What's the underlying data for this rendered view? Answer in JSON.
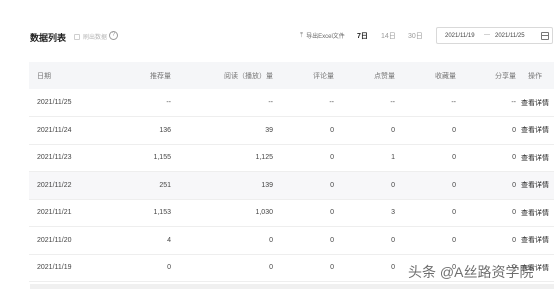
{
  "header": {
    "title": "数据列表",
    "brush_label": "刷出数据",
    "help_icon": "question-circle-icon",
    "export_icon": "upload-icon",
    "export_label": "导出Excel文件",
    "ranges": [
      "7日",
      "14日",
      "30日"
    ],
    "active_range": "7日",
    "date_start": "2021/11/19",
    "date_separator": "—",
    "date_end": "2021/11/25",
    "calendar_icon": "calendar-icon"
  },
  "table": {
    "columns": [
      "日期",
      "推荐量",
      "阅读（播放）量",
      "评论量",
      "点赞量",
      "收藏量",
      "分享量",
      "操作"
    ],
    "rows": [
      [
        "2021/11/25",
        "--",
        "--",
        "--",
        "--",
        "--",
        "--",
        "查看详情"
      ],
      [
        "2021/11/24",
        "136",
        "39",
        "0",
        "0",
        "0",
        "0",
        "查看详情"
      ],
      [
        "2021/11/23",
        "1,155",
        "1,125",
        "0",
        "1",
        "0",
        "0",
        "查看详情"
      ],
      [
        "2021/11/22",
        "251",
        "139",
        "0",
        "0",
        "0",
        "0",
        "查看详情"
      ],
      [
        "2021/11/21",
        "1,153",
        "1,030",
        "0",
        "3",
        "0",
        "0",
        "查看详情"
      ],
      [
        "2021/11/20",
        "4",
        "0",
        "0",
        "0",
        "0",
        "0",
        "查看详情"
      ],
      [
        "2021/11/19",
        "0",
        "0",
        "0",
        "0",
        "0",
        "0",
        "查看详情"
      ]
    ],
    "highlighted_row": 3
  },
  "watermark": "头条 @A丝路资学院",
  "colors": {
    "header_bg": "#f5f6f8",
    "border": "#eeeeee",
    "active_text": "#222222",
    "muted_text": "#999999"
  }
}
